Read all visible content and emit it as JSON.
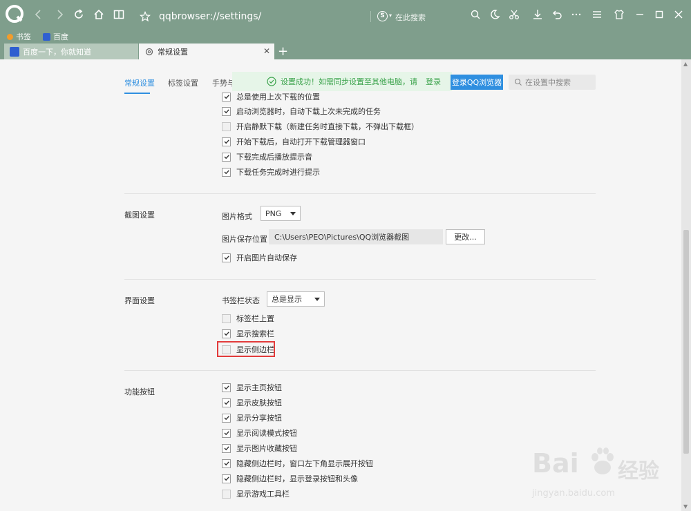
{
  "browser": {
    "address": "qqbrowser://settings/",
    "search_engine_glyph": "S",
    "search_placeholder": "在此搜索",
    "bookmarks": [
      {
        "label": "书签"
      },
      {
        "label": "百度"
      }
    ],
    "tabs": [
      {
        "label": "百度一下，你就知道",
        "active": false
      },
      {
        "label": "常规设置",
        "active": true
      }
    ],
    "new_tab": "+",
    "close_tab": "✕"
  },
  "settings": {
    "nav_tabs": [
      "常规设置",
      "标签设置",
      "手势与"
    ],
    "toast_text": "设置成功！如需同步设置至其他电脑，请",
    "toast_login_link": "登录",
    "login_button": "登录QQ浏览器",
    "search_placeholder": "在设置中搜索",
    "download_options": [
      {
        "label": "总是使用上次下载的位置",
        "checked": true
      },
      {
        "label": "启动浏览器时，自动下载上次未完成的任务",
        "checked": true
      },
      {
        "label": "开启静默下载（新建任务时直接下载，不弹出下载框）",
        "checked": false
      },
      {
        "label": "开始下载后，自动打开下载管理器窗口",
        "checked": true
      },
      {
        "label": "下载完成后播放提示音",
        "checked": true
      },
      {
        "label": "下载任务完成时进行提示",
        "checked": true
      }
    ],
    "screenshot": {
      "section_label": "截图设置",
      "format_label": "图片格式",
      "format_value": "PNG",
      "path_label": "图片保存位置",
      "path_value": "C:\\Users\\PEO\\Pictures\\QQ浏览器截图",
      "change_button": "更改...",
      "auto_save": {
        "label": "开启图片自动保存",
        "checked": true
      }
    },
    "interface": {
      "section_label": "界面设置",
      "bookmark_bar_label": "书签栏状态",
      "bookmark_bar_value": "总是显示",
      "options": [
        {
          "label": "标签栏上置",
          "checked": false
        },
        {
          "label": "显示搜索栏",
          "checked": true
        },
        {
          "label": "显示侧边栏",
          "checked": false
        }
      ]
    },
    "buttons": {
      "section_label": "功能按钮",
      "options": [
        {
          "label": "显示主页按钮",
          "checked": true
        },
        {
          "label": "显示皮肤按钮",
          "checked": true
        },
        {
          "label": "显示分享按钮",
          "checked": true
        },
        {
          "label": "显示阅读模式按钮",
          "checked": true
        },
        {
          "label": "显示图片收藏按钮",
          "checked": true
        },
        {
          "label": "隐藏侧边栏时，窗口左下角显示展开按钮",
          "checked": true
        },
        {
          "label": "隐藏侧边栏时，显示登录按钮和头像",
          "checked": true
        },
        {
          "label": "显示游戏工具栏",
          "checked": false
        }
      ]
    }
  },
  "watermark": {
    "brand": "Bai",
    "brand_suffix": "经验",
    "url": "jingyan.baidu.com"
  },
  "colors": {
    "chrome": "#7f9e8c",
    "accent": "#2f8fe0",
    "toast_green": "#3aa24a",
    "highlight": "#e23b3b"
  }
}
